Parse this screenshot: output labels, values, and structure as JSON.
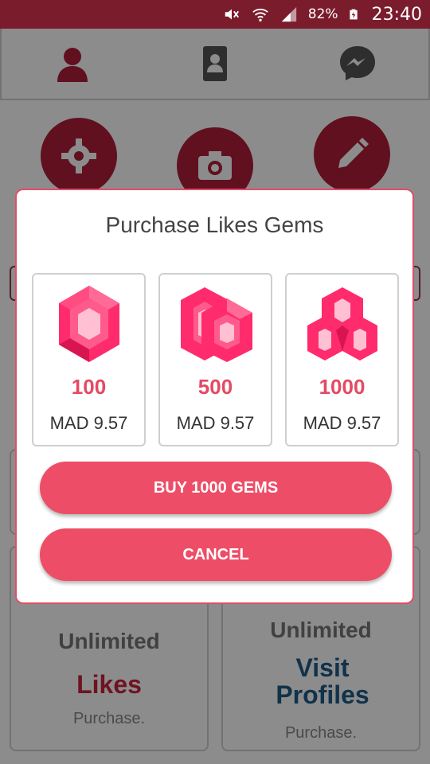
{
  "status_bar": {
    "battery": "82%",
    "time": "23:40",
    "icons": [
      "mute-icon",
      "wifi-icon",
      "signal-icon",
      "battery-icon"
    ]
  },
  "top_nav": {
    "icons": [
      "profile-icon",
      "contacts-icon",
      "messenger-icon"
    ]
  },
  "background": {
    "actions": [
      "gear-icon",
      "camera-icon",
      "pencil-icon"
    ],
    "cards": [
      {
        "unlimited": "Unlimited",
        "feature": "Likes",
        "purchase": "Purchase.",
        "feature_color": "#c8243e"
      },
      {
        "unlimited": "Unlimited",
        "feature": "Visit Profiles",
        "purchase": "Purchase.",
        "feature_color": "#1e5c88"
      }
    ]
  },
  "dialog": {
    "title": "Purchase Likes Gems",
    "options": [
      {
        "quantity": "100",
        "price": "MAD 9.57",
        "icon": "single-gem-icon"
      },
      {
        "quantity": "500",
        "price": "MAD 9.57",
        "icon": "double-gem-icon"
      },
      {
        "quantity": "1000",
        "price": "MAD 9.57",
        "icon": "cluster-gem-icon"
      }
    ],
    "buy_label": "BUY 1000 GEMS",
    "cancel_label": "CANCEL"
  },
  "colors": {
    "accent": "#ee4d67",
    "status_bar": "#7a1c2c",
    "gem": "#ff2b6c"
  }
}
